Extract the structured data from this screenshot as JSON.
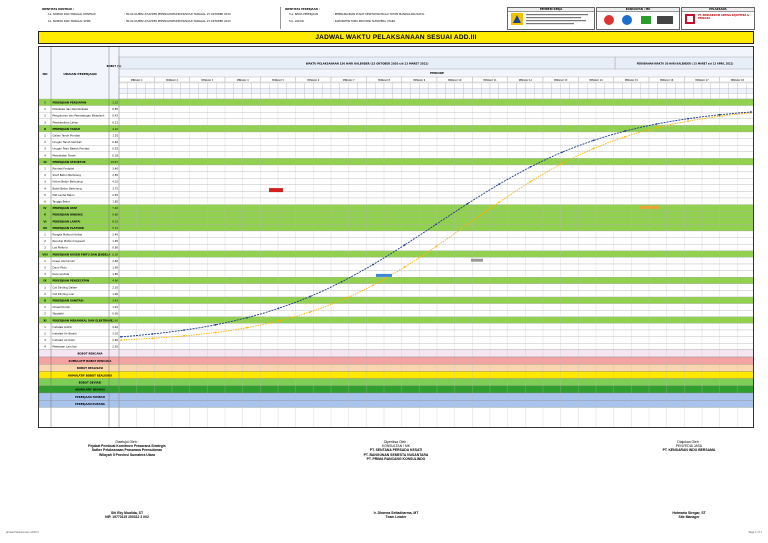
{
  "header": {
    "contract_heading": "IDENTITAS KONTRAK :",
    "contract_rows": [
      {
        "label": "1a. NOMOR DAN TANGGAL KONTRAK",
        "value": ": HK.02.01/BB2.2/SATKER PPPSB/ADDPSP.PUPR/SUSD TANGGAL 15 OKTOBER 2020"
      },
      {
        "label": "1b. NOMOR DAN TANGGAL SPMK",
        "value": ": HK.02.01/BB2.2/SATKER PPPSB/ADDPSP.PUPR/SUSD TANGGAL 15 OKTOBER 2020"
      }
    ],
    "work_heading": "IDENTITAS PEKERJAAN :",
    "work_rows": [
      {
        "label": "5.a. NAMA PEKERJAAN",
        "value": ": PEMBANGUNAN PUSAT KESEHATAN BALAI TATON MANDAILING NATAL"
      },
      {
        "label": "5.b. LOKASI",
        "value": ": KABUPATEN TOBA PROVINSI SUMATERA UTARA"
      }
    ],
    "boxes": [
      {
        "title": "PEMBERI KERJA"
      },
      {
        "title": "KONSULTAN / MK"
      },
      {
        "title": "PELAKSANA"
      }
    ],
    "kso_text": "PT. KONSORSIUM ANYING SEJAHTERA & PERKASA"
  },
  "banner": {
    "title": "JADWAL WAKTU PELAKSANAAN SESUAI ADD.III"
  },
  "grid": {
    "col_no": "NO",
    "col_uraian": "URAIAN PEKERJAAN",
    "col_bobot": "BOBOT (%)",
    "period_left": "WAKTU PELAKSANAAN 150 HARI KALENDER (15 OKTOBER 2020 s/d 13 MARET 2021)",
    "period_right": "PERUBAHAN WAKTU 30 HARI KALENDER ( 15 MARET s/d 13 APRIL 2021)",
    "periode": "PERIODE",
    "months": [
      "MINGGU 1",
      "MINGGU 2",
      "MINGGU 3",
      "MINGGU 4",
      "MINGGU 5",
      "MINGGU 6",
      "MINGGU 7",
      "MINGGU 8",
      "MINGGU 9",
      "MINGGU 10",
      "MINGGU 11",
      "MINGGU 12",
      "MINGGU 13",
      "MINGGU 14",
      "MINGGU 15",
      "MINGGU 16",
      "MINGGU 17",
      "MINGGU 18"
    ],
    "rows": [
      {
        "no": "I",
        "label": "PEKERJAAN PERSIAPAN",
        "bobot": "2.32",
        "type": "section"
      },
      {
        "no": "1",
        "label": "Mobilisasi dan Demobilisasi",
        "bobot": "0.85",
        "type": "item"
      },
      {
        "no": "2",
        "label": "Pengukuran dan Pemasangan Bowplank",
        "bobot": "0.42",
        "type": "item"
      },
      {
        "no": "3",
        "label": "Pembersihan Lahan",
        "bobot": "0.21",
        "type": "item"
      },
      {
        "no": "II",
        "label": "PEKERJAAN TANAH",
        "bobot": "4.10",
        "type": "section"
      },
      {
        "no": "1",
        "label": "Galian Tanah Pondasi",
        "bobot": "1.20",
        "type": "item"
      },
      {
        "no": "2",
        "label": "Urugan Tanah Kembali",
        "bobot": "0.60",
        "type": "item"
      },
      {
        "no": "3",
        "label": "Urugan Pasir Bawah Pondasi",
        "bobot": "0.55",
        "type": "item"
      },
      {
        "no": "4",
        "label": "Pemadatan Tanah",
        "bobot": "0.38",
        "type": "item"
      },
      {
        "no": "III",
        "label": "PEKERJAAN STRUKTUR",
        "bobot": "18.65",
        "type": "section"
      },
      {
        "no": "1",
        "label": "Pondasi Footplat",
        "bobot": "3.40",
        "type": "item"
      },
      {
        "no": "2",
        "label": "Sloof Beton Bertulang",
        "bobot": "2.85",
        "type": "item"
      },
      {
        "no": "3",
        "label": "Kolom Beton Bertulang",
        "bobot": "4.10",
        "type": "item"
      },
      {
        "no": "4",
        "label": "Balok Beton Bertulang",
        "bobot": "3.75",
        "type": "item"
      },
      {
        "no": "5",
        "label": "Plat Lantai Beton",
        "bobot": "2.95",
        "type": "item"
      },
      {
        "no": "6",
        "label": "Tangga Beton",
        "bobot": "1.60",
        "type": "item"
      },
      {
        "no": "IV",
        "label": "PEKERJAAN ATAP",
        "bobot": "7.40",
        "type": "section"
      },
      {
        "no": "V",
        "label": "PEKERJAAN DINDING",
        "bobot": "9.80",
        "type": "section"
      },
      {
        "no": "VI",
        "label": "PEKERJAAN LANTAI",
        "bobot": "8.25",
        "type": "section"
      },
      {
        "no": "VII",
        "label": "PEKERJAAN PLAFOND",
        "bobot": "5.15",
        "type": "section"
      },
      {
        "no": "1",
        "label": "Rangka Plafond Hollow",
        "bobot": "2.40",
        "type": "item"
      },
      {
        "no": "2",
        "label": "Penutup Plafond Gypsum",
        "bobot": "1.95",
        "type": "item"
      },
      {
        "no": "3",
        "label": "List Plafond",
        "bobot": "0.80",
        "type": "item"
      },
      {
        "no": "VIII",
        "label": "PEKERJAAN KUSEN PINTU DAN JENDELA",
        "bobot": "6.30",
        "type": "section"
      },
      {
        "no": "1",
        "label": "Kusen Aluminium",
        "bobot": "2.60",
        "type": "item"
      },
      {
        "no": "2",
        "label": "Daun Pintu",
        "bobot": "1.90",
        "type": "item"
      },
      {
        "no": "3",
        "label": "Kaca Jendela",
        "bobot": "1.80",
        "type": "item"
      },
      {
        "no": "IX",
        "label": "PEKERJAAN PENGECATAN",
        "bobot": "4.90",
        "type": "section"
      },
      {
        "no": "1",
        "label": "Cat Dinding Dalam",
        "bobot": "2.10",
        "type": "item"
      },
      {
        "no": "2",
        "label": "Cat Dinding Luar",
        "bobot": "1.90",
        "type": "item"
      },
      {
        "no": "X",
        "label": "PEKERJAAN SANITASI",
        "bobot": "3.45",
        "type": "section"
      },
      {
        "no": "1",
        "label": "Closet Duduk",
        "bobot": "1.20",
        "type": "item"
      },
      {
        "no": "2",
        "label": "Wastafel",
        "bobot": "0.95",
        "type": "item"
      },
      {
        "no": "XI",
        "label": "PEKERJAAN MEKANIKAL DAN ELEKTRIKAL",
        "bobot": "12.60",
        "type": "section"
      },
      {
        "no": "1",
        "label": "Instalasi Listrik",
        "bobot": "4.40",
        "type": "item"
      },
      {
        "no": "2",
        "label": "Instalasi Air Bersih",
        "bobot": "3.10",
        "type": "item"
      },
      {
        "no": "3",
        "label": "Instalasi Air Kotor",
        "bobot": "2.60",
        "type": "item"
      },
      {
        "no": "4",
        "label": "Pekerjaan Lain-lain",
        "bobot": "2.50",
        "type": "item"
      }
    ],
    "summary_rows": [
      {
        "label": "BOBOT RENCANA",
        "color": "#f6e6f4"
      },
      {
        "label": "KUMULATIF BOBOT RENCANA",
        "color": "#f4a3a3"
      },
      {
        "label": "BOBOT REALISASI",
        "color": "#f9d6b0"
      },
      {
        "label": "KUMULATIF BOBOT REALISASI",
        "color": "#ffe800"
      },
      {
        "label": "BOBOT DEVIASI",
        "color": "#7ccf54"
      },
      {
        "label": "KUMULATIF DEVIASI",
        "color": "#2f9e2f"
      },
      {
        "label": "PEKERJAAN TAMBAH",
        "color": "#a9c4ec"
      },
      {
        "label": "PEKERJAAN KURANG",
        "color": "#a9c4ec"
      }
    ]
  },
  "signatures": [
    {
      "role": "Disetujui Oleh :",
      "org1": "Pejabat Pembuat Komitmen Prasarana Strategis",
      "org2": "Satker Pelaksanaan Prasarana Permukiman",
      "org3": "Wilayah II Provinsi Sumatera Utara",
      "name": "Siti Eky Mualida, ST",
      "id": "NIP. 19770115 200312 2 002"
    },
    {
      "role": "Diperiksa Oleh :",
      "org1": "KONSULTAN / MK",
      "org2": "PT. SENTANA PERSADA KESATI",
      "org3": "PT. BANGUNAN SEMESTA NUSANTARA",
      "org4": "PT. PRIMA RANCANG KONSULINDO",
      "name": "Ir. Dharma Setiadharma, MT",
      "id": "Team Leader"
    },
    {
      "role": "Diajukan Oleh :",
      "org1": "PENYEDIA JASA",
      "org2": "PT. KENDARAN INDO BERSAMA",
      "name": "Hotmaria Siregar, ST",
      "id": "Site Manager"
    }
  ],
  "footer": {
    "left": "Jadwal Pelaksanaan ADD.III",
    "right": "Page 1 of 1"
  },
  "colors": {
    "plan_curve": "#ffb300",
    "actual_curve": "#1e3c8c",
    "section_green": "#92d050",
    "banner_yellow": "#ffeb00"
  }
}
